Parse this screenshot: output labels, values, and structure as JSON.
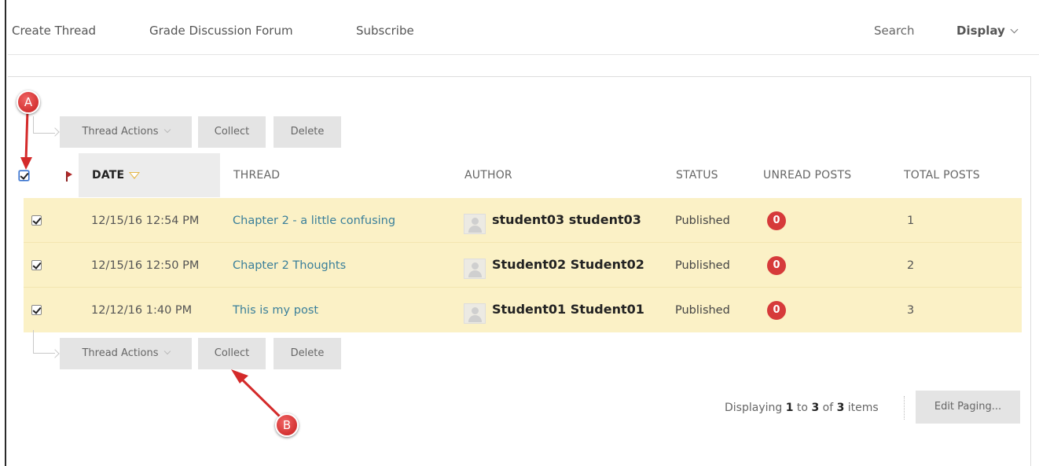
{
  "toolbar": {
    "create_thread": "Create Thread",
    "grade_forum": "Grade Discussion Forum",
    "subscribe": "Subscribe",
    "search": "Search",
    "display": "Display"
  },
  "actions": {
    "thread_actions": "Thread Actions",
    "collect": "Collect",
    "delete": "Delete"
  },
  "table": {
    "headers": {
      "date": "DATE",
      "thread": "THREAD",
      "author": "AUTHOR",
      "status": "STATUS",
      "unread": "UNREAD POSTS",
      "total": "TOTAL POSTS"
    },
    "select_all_checked": true,
    "rows": [
      {
        "checked": true,
        "date": "12/15/16 12:54 PM",
        "thread": "Chapter 2 - a little confusing",
        "author": "student03 student03",
        "status": "Published",
        "unread": "0",
        "total": "1"
      },
      {
        "checked": true,
        "date": "12/15/16 12:50 PM",
        "thread": "Chapter 2 Thoughts",
        "author": "Student02 Student02",
        "status": "Published",
        "unread": "0",
        "total": "2"
      },
      {
        "checked": true,
        "date": "12/12/16 1:40 PM",
        "thread": "This is my post",
        "author": "Student01 Student01",
        "status": "Published",
        "unread": "0",
        "total": "3"
      }
    ]
  },
  "paging": {
    "prefix": "Displaying",
    "from": "1",
    "to_word": "to",
    "to": "3",
    "of_word": "of",
    "total": "3",
    "suffix": "items",
    "edit_label": "Edit Paging..."
  },
  "annotations": {
    "a_label": "A",
    "b_label": "B"
  },
  "colors": {
    "selected_row": "#fbf1c6",
    "badge": "#d63a3a",
    "link": "#3a7f9a",
    "marker": "#d42a2a"
  }
}
